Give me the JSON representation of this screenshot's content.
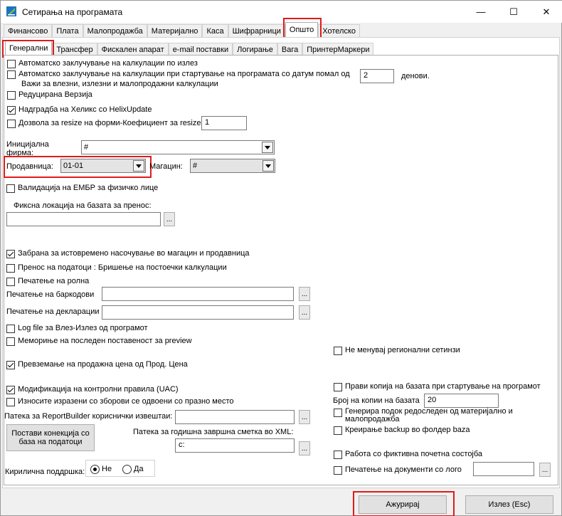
{
  "window": {
    "title": "Сетирања на програмата",
    "minimize": "—",
    "maximize": "☐",
    "close": "✕"
  },
  "top_tabs": [
    "Финансово",
    "Плата",
    "Малопродажба",
    "Материјално",
    "Каса",
    "Шифрарници",
    "Општо",
    "Хотелско"
  ],
  "top_active": "Општо",
  "sub_tabs": [
    "Генерални",
    "Трансфер",
    "Фискален апарат",
    "e-mail поставки",
    "Логирање",
    "Вага",
    "ПринтерМаркери"
  ],
  "sub_active": "Генерални",
  "opts": {
    "auto_close_exit": {
      "label": "Автоматско заклучување на калкулации по излез",
      "checked": false
    },
    "auto_close_start": {
      "label": "Автоматско заклучување на калкулации при стартување на програмата со датум помал од",
      "checked": false
    },
    "auto_close_note": "Важи за влезни, излезни и малопродажни калкулации",
    "days_value": "2",
    "days_label": "денови.",
    "reduced": {
      "label": "Редуцирана Верзија",
      "checked": false
    },
    "upgrade": {
      "label": "Надградба на Хеликс со HelixUpdate",
      "checked": true
    },
    "resize": {
      "label": "Дозвола за resize на форми-Коефициент за resize",
      "checked": false
    },
    "resize_value": "1"
  },
  "fields": {
    "initial_firm_label": "Иницијална фирма:",
    "initial_firm_value": "#",
    "shop_label": "Продавница:",
    "shop_value": "01-01",
    "warehouse_label": "Магацин:",
    "warehouse_value": "#"
  },
  "embr": {
    "label": "Валидација на ЕМБР за физичко лице",
    "checked": false
  },
  "fixed_location_label": "Фиксна локација на базата за пренос:",
  "fixed_location_value": "",
  "opts2": {
    "forbid_input": {
      "label": "Забрана за истовремено насочување во магацин и продавница",
      "checked": true
    },
    "transfer_delete": {
      "label": "Пренос на податоци : Бришење на постоечки калкулации",
      "checked": false
    },
    "roll_print": {
      "label": "Печатење на ролна",
      "checked": false
    }
  },
  "barcode_label": "Печатење на баркодови",
  "barcode_value": "",
  "declaration_label": "Печатење на декларации",
  "declaration_value": "",
  "opts3": {
    "log_file": {
      "label": "Log file за Влез-Излез од програмот",
      "checked": false
    },
    "memorize_preview": {
      "label": "Мемориње на последен поставеност за preview",
      "checked": false
    },
    "no_regional": {
      "label": "Не менувај регионални сетинзи",
      "checked": false
    },
    "take_price": {
      "label": "Превземање на продажна цена од Прод. Цена",
      "checked": true
    },
    "uac": {
      "label": "Модификација на контролни правила (UAC)",
      "checked": true
    },
    "export_words": {
      "label": "Износите изразени со зборови се одвоени со празно место",
      "checked": false
    },
    "db_copy": {
      "label": "Прави копија на базата при стартување на програмот",
      "checked": false
    },
    "gen_order": {
      "label": "Генерира подок редоследен од материјално и малопродажба",
      "checked": false
    },
    "backup": {
      "label": "Креирање backup во фолдер baza",
      "checked": false
    },
    "fictive": {
      "label": "Работа со фиктивна почетна состојба",
      "checked": false
    },
    "print_logo": {
      "label": "Печатење на документи со лого",
      "checked": false
    }
  },
  "copies_label": "Број на копии на базата",
  "copies_value": "20",
  "reportbuilder_label": "Патека за ReportBuilder кориснички извештаи:",
  "reportbuilder_value": "",
  "connection_button": "Постави конекција со база на податоци",
  "annual_label": "Патека за годишна завршна сметка во XML:",
  "annual_value": "c:",
  "logo_value": "",
  "cyrillic_label": "Кирилична поддршка:",
  "radio_no": "Не",
  "radio_yes": "Да",
  "dots": "...",
  "update_button": "Ажурирај",
  "exit_button": "Излез (Esc)",
  "colors": {
    "highlight": "#e01a1a"
  }
}
